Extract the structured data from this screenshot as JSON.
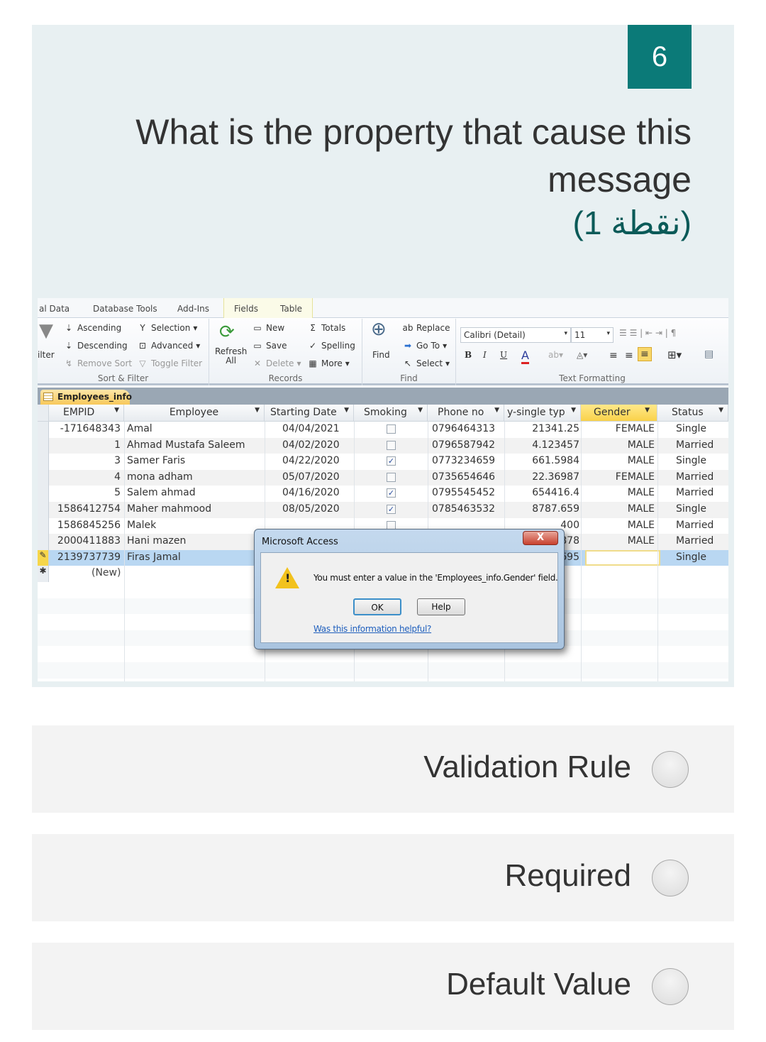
{
  "question": {
    "number": "6",
    "title": "What is the property that cause this message",
    "points": "(1 نقطة)"
  },
  "access": {
    "ribbon_tabs": [
      "al Data",
      "Database Tools",
      "Add-Ins",
      "Fields",
      "Table"
    ],
    "groups": {
      "sort_filter": {
        "label": "Sort & Filter",
        "filter": "ilter",
        "ascending": "Ascending",
        "descending": "Descending",
        "remove_sort": "Remove Sort",
        "selection": "Selection",
        "advanced": "Advanced",
        "toggle_filter": "Toggle Filter"
      },
      "records": {
        "label": "Records",
        "refresh": "Refresh",
        "refresh_all": "All",
        "new": "New",
        "save": "Save",
        "delete": "Delete",
        "totals": "Totals",
        "spelling": "Spelling",
        "more": "More"
      },
      "find": {
        "label": "Find",
        "find": "Find",
        "replace": "Replace",
        "goto": "Go To",
        "select": "Select"
      },
      "text_formatting": {
        "label": "Text Formatting",
        "font": "Calibri (Detail)",
        "size": "11",
        "bold": "B",
        "italic": "I",
        "underline": "U"
      }
    },
    "table_tab": "Employees_info",
    "columns": [
      "EMPID",
      "Employee",
      "Starting Date",
      "Smoking",
      "Phone no",
      "y-single typ",
      "Gender",
      "Status"
    ],
    "rows": [
      {
        "empid": "-171648343",
        "employee": "Amal",
        "date": "04/04/2021",
        "smoking": false,
        "phone": "0796464313",
        "single": "21341.25",
        "gender": "FEMALE",
        "status": "Single"
      },
      {
        "empid": "1",
        "employee": "Ahmad Mustafa Saleem",
        "date": "04/02/2020",
        "smoking": false,
        "phone": "0796587942",
        "single": "4.123457",
        "gender": "MALE",
        "status": "Married"
      },
      {
        "empid": "3",
        "employee": "Samer Faris",
        "date": "04/22/2020",
        "smoking": true,
        "phone": "0773234659",
        "single": "661.5984",
        "gender": "MALE",
        "status": "Single"
      },
      {
        "empid": "4",
        "employee": "mona adham",
        "date": "05/07/2020",
        "smoking": false,
        "phone": "0735654646",
        "single": "22.36987",
        "gender": "FEMALE",
        "status": "Married"
      },
      {
        "empid": "5",
        "employee": "Salem ahmad",
        "date": "04/16/2020",
        "smoking": true,
        "phone": "0795545452",
        "single": "654416.4",
        "gender": "MALE",
        "status": "Married"
      },
      {
        "empid": "1586412754",
        "employee": "Maher mahmood",
        "date": "08/05/2020",
        "smoking": true,
        "phone": "0785463532",
        "single": "8787.659",
        "gender": "MALE",
        "status": "Single"
      },
      {
        "empid": "1586845256",
        "employee": "Malek",
        "date": "",
        "smoking": false,
        "phone": "",
        "single": "400",
        "gender": "MALE",
        "status": "Married"
      },
      {
        "empid": "2000411883",
        "employee": "Hani mazen",
        "date": "",
        "smoking": false,
        "phone": "",
        "single": "878",
        "gender": "MALE",
        "status": "Married"
      },
      {
        "empid": "2139737739",
        "employee": "Firas Jamal",
        "date": "",
        "smoking": false,
        "phone": "",
        "single": "695",
        "gender": "",
        "status": "Single"
      }
    ],
    "new_row": "(New)",
    "dialog": {
      "title": "Microsoft Access",
      "close": "X",
      "message": "You must enter a value in the 'Employees_info.Gender' field.",
      "ok": "OK",
      "help": "Help",
      "link": "Was this information helpful?"
    }
  },
  "options": [
    {
      "label": "Validation Rule",
      "selected": false
    },
    {
      "label": "Required",
      "selected": false
    },
    {
      "label": "Default Value",
      "selected": false
    }
  ]
}
